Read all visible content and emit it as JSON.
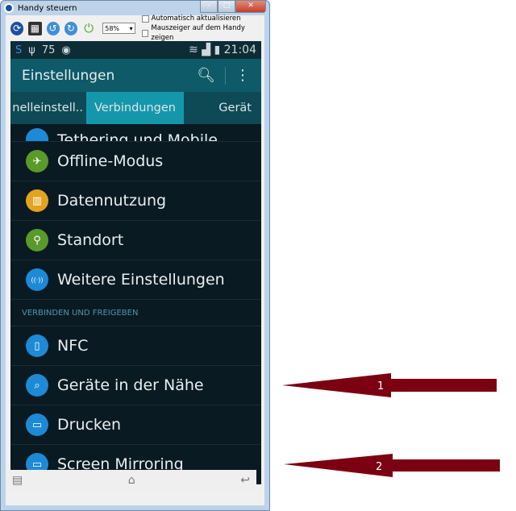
{
  "window": {
    "title": "Handy steuern"
  },
  "toolbar": {
    "zoom": "58%",
    "auto_update": "Automatisch aktualisieren",
    "show_pointer": "Mauszeiger auf dem Handy zeigen"
  },
  "status": {
    "battery": "75",
    "time": "21:04"
  },
  "actionbar": {
    "title": "Einstellungen"
  },
  "tabs": [
    {
      "label": "nelleinstell.."
    },
    {
      "label": "Verbindungen"
    },
    {
      "label": "Gerät"
    }
  ],
  "list": {
    "partial": "Tethering und Mobile..",
    "items": [
      {
        "label": "Offline-Modus",
        "icon": "airplane-icon",
        "color": "#5a9a2a"
      },
      {
        "label": "Datennutzung",
        "icon": "bar-chart-icon",
        "color": "#e3a31f"
      },
      {
        "label": "Standort",
        "icon": "location-icon",
        "color": "#5a9a2a"
      },
      {
        "label": "Weitere Einstellungen",
        "icon": "antenna-icon",
        "color": "#1d8ad6"
      }
    ],
    "section": "VERBINDEN UND FREIGEBEN",
    "items2": [
      {
        "label": "NFC",
        "icon": "nfc-icon",
        "color": "#1d8ad6"
      },
      {
        "label": "Geräte in der Nähe",
        "icon": "nearby-devices-icon",
        "color": "#1d8ad6"
      },
      {
        "label": "Drucken",
        "icon": "printer-icon",
        "color": "#1d8ad6"
      },
      {
        "label": "Screen Mirroring",
        "icon": "screen-mirroring-icon",
        "color": "#1d8ad6"
      }
    ]
  },
  "annotations": [
    {
      "label": "1",
      "color": "#7a0012"
    },
    {
      "label": "2",
      "color": "#7a0012"
    }
  ]
}
